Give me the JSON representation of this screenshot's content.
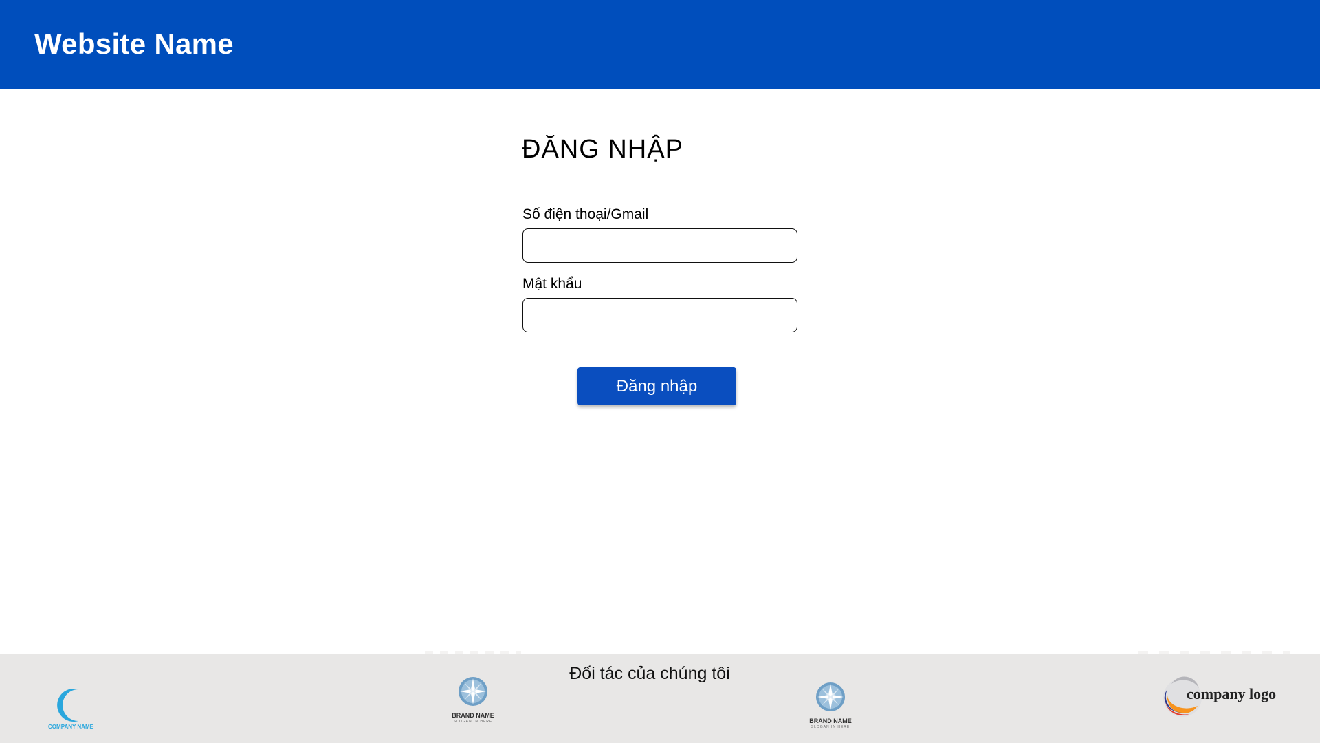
{
  "header": {
    "site_title": "Website Name",
    "background_color": "#004ebc"
  },
  "login": {
    "title": "ĐĂNG NHẬP",
    "phone_label": "Số điện thoại/Gmail",
    "phone_value": "",
    "password_label": "Mật khẩu",
    "password_value": "",
    "submit_label": "Đăng nhập",
    "button_color": "#0a4ebf"
  },
  "footer": {
    "partners_title": "Đối tác của chúng tôi",
    "background_color": "#e8e7e6",
    "logos": [
      {
        "icon": "crescent-logo-icon",
        "caption": "COMPANY NAME"
      },
      {
        "icon": "compass-star-logo-icon",
        "caption": "BRAND NAME",
        "slogan": "SLOGAN IN HERE"
      },
      {
        "icon": "compass-star-logo-icon",
        "caption": "BRAND NAME",
        "slogan": "SLOGAN IN HERE"
      },
      {
        "icon": "swoosh-circle-logo-icon",
        "caption": "company logo"
      }
    ]
  }
}
